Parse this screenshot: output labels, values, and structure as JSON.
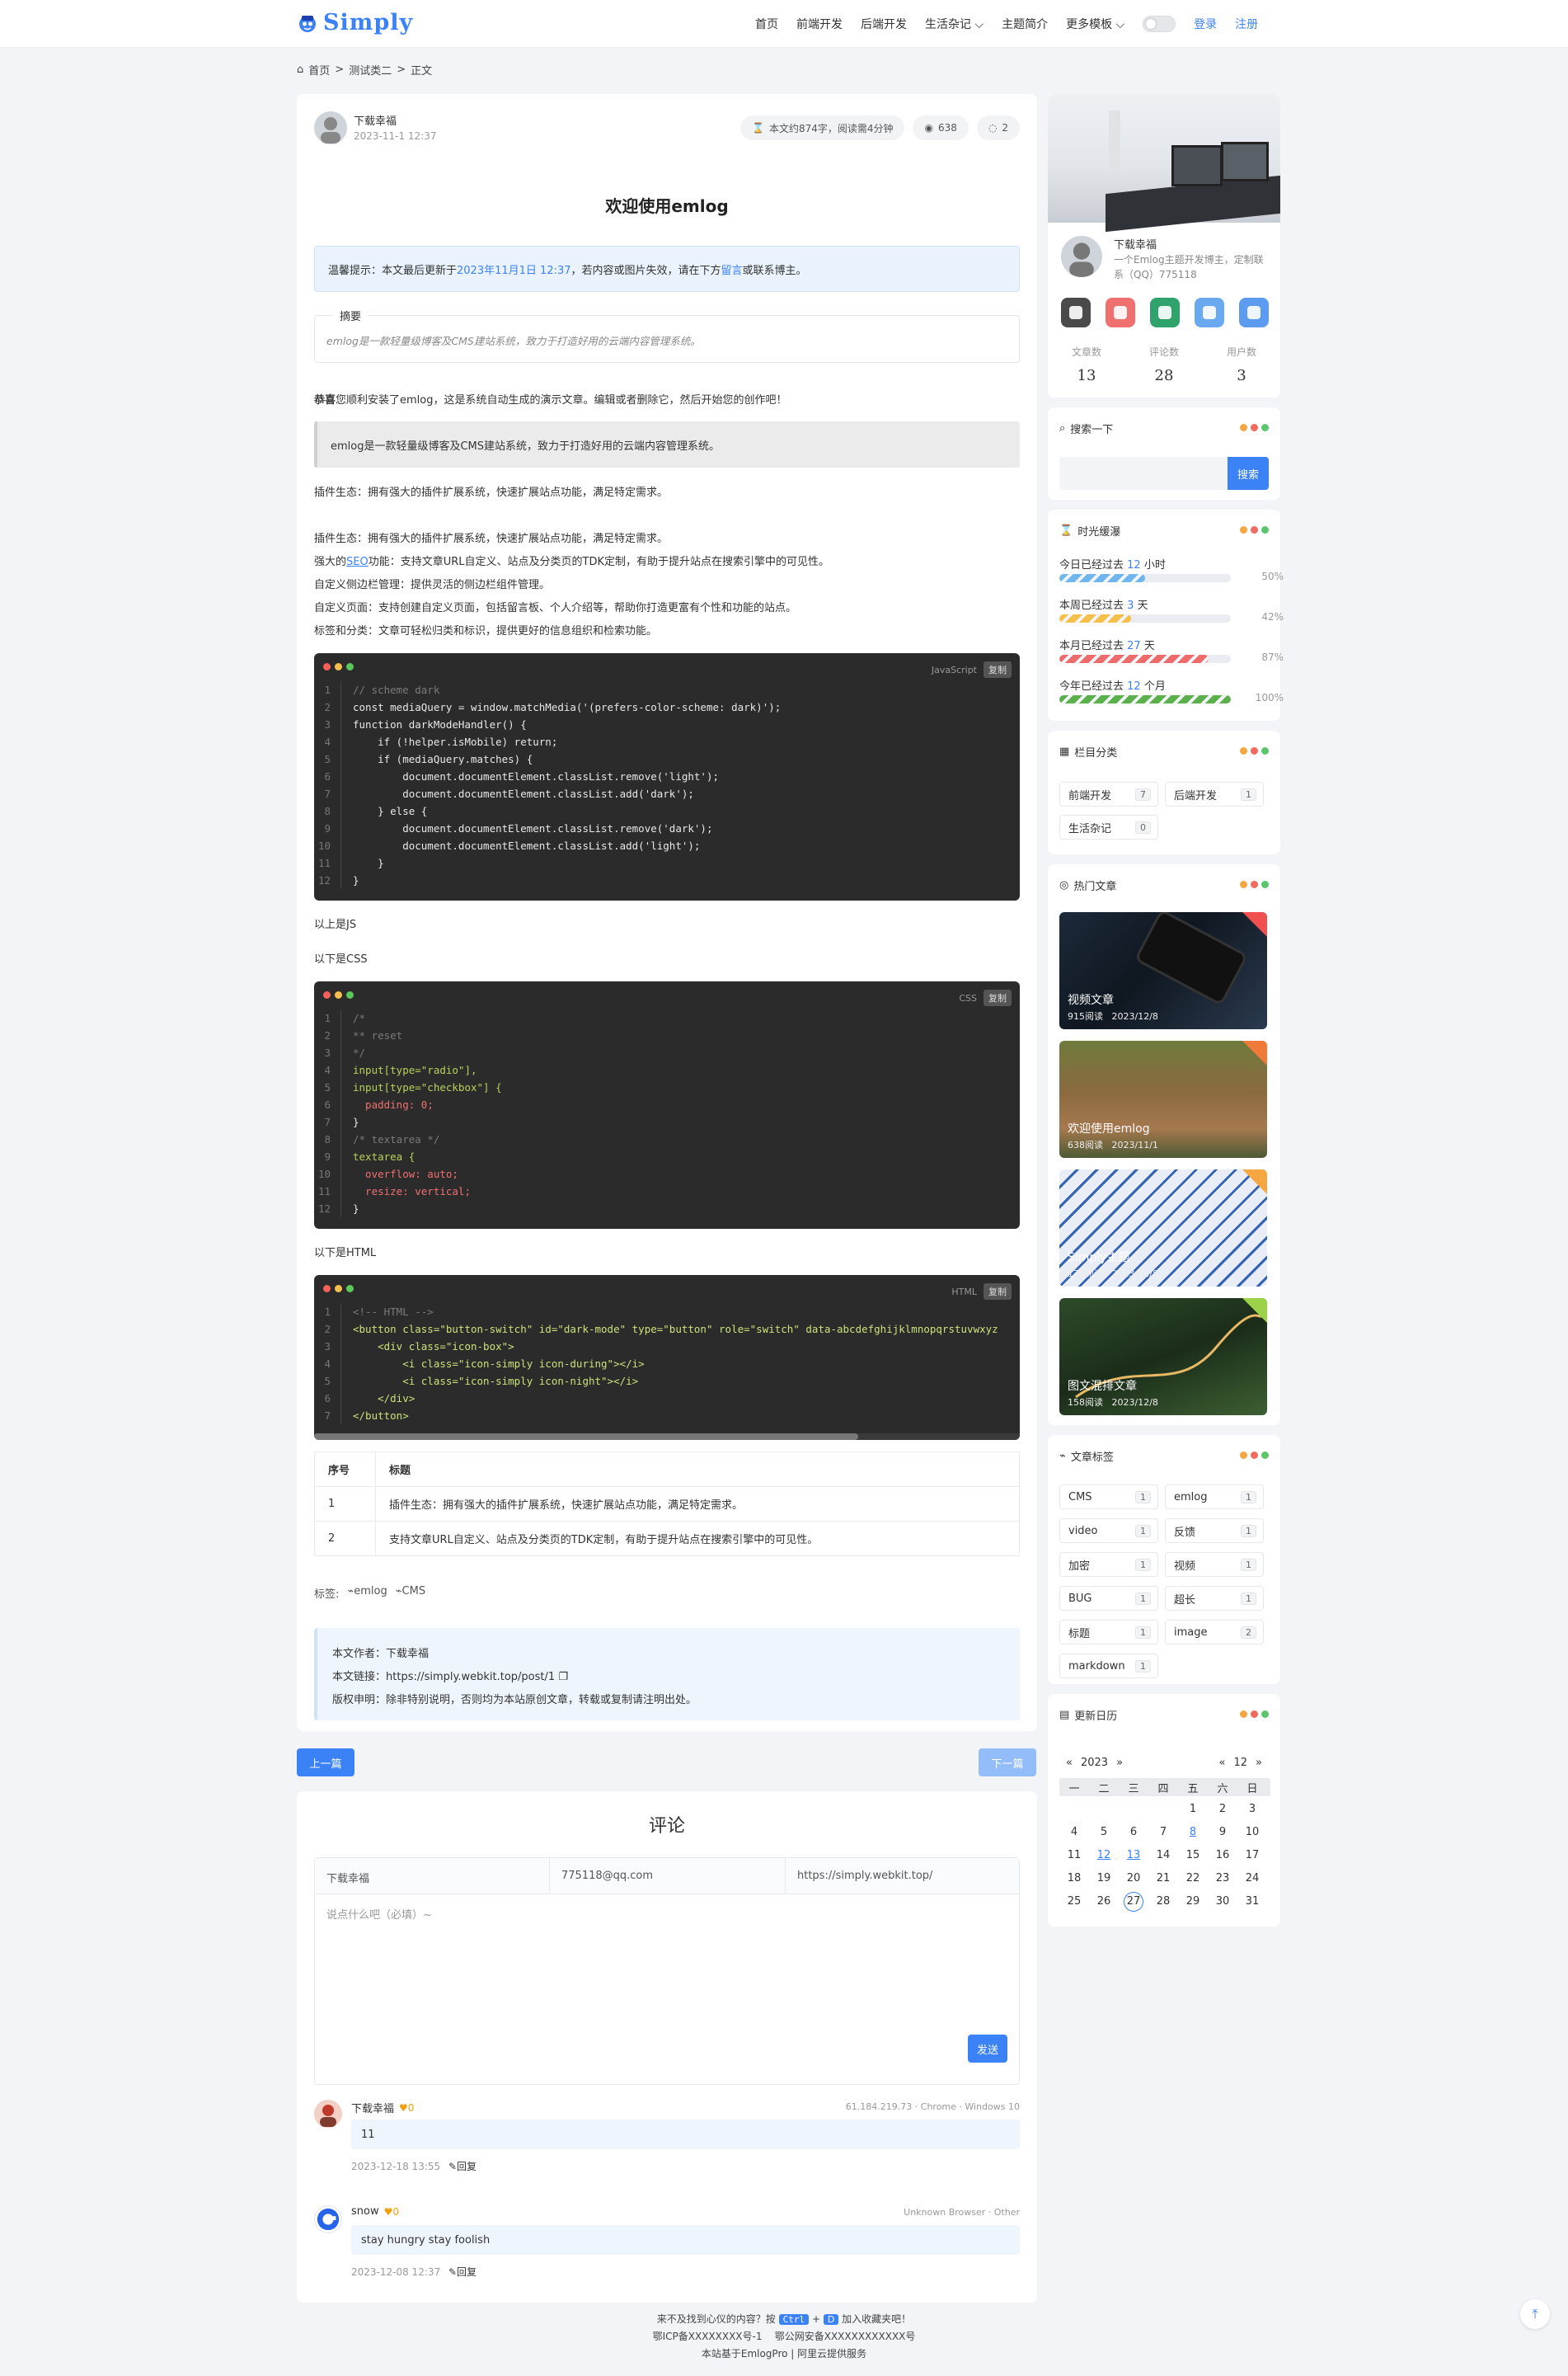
{
  "header": {
    "logo_text": "Simply",
    "nav": [
      "首页",
      "前端开发",
      "后端开发",
      "生活杂记",
      "主题简介",
      "更多模板"
    ],
    "login": "登录",
    "register": "注册"
  },
  "breadcrumb": [
    "首页",
    "测试类二",
    "正文"
  ],
  "article": {
    "author": "下载幸福",
    "date": "2023-11-1 12:37",
    "word_count": "本文约874字，阅读需4分钟",
    "views": "638",
    "comments": "2",
    "title": "欢迎使用emlog",
    "notice_prefix": "温馨提示：本文最后更新于",
    "notice_date": "2023年11月1日 12:37",
    "notice_mid": "，若内容或图片失效，请在下方",
    "notice_link": "留言",
    "notice_suffix": "或联系博主。",
    "summary_title": "摘要",
    "summary": "emlog是一款轻量级博客及CMS建站系统，致力于打造好用的云端内容管理系统。",
    "intro_bold": "恭喜",
    "intro_rest": "您顺利安装了emlog，这是系统自动生成的演示文章。编辑或者删除它，然后开始您的创作吧！",
    "quote": "emlog是一款轻量级博客及CMS建站系统，致力于打造好用的云端内容管理系统。",
    "p1": "插件生态：拥有强大的插件扩展系统，快速扩展站点功能，满足特定需求。",
    "list": [
      "插件生态：拥有强大的插件扩展系统，快速扩展站点功能，满足特定需求。",
      "强大的SEO功能：支持文章URL自定义、站点及分类页的TDK定制，有助于提升站点在搜索引擎中的可见性。",
      "自定义侧边栏管理：提供灵活的侧边栏组件管理。",
      "自定义页面：支持创建自定义页面，包括留言板、个人介绍等，帮助你打造更富有个性和功能的站点。",
      "标签和分类：文章可轻松归类和标识，提供更好的信息组织和检索功能。"
    ],
    "code_js_lang": "JavaScript",
    "code_copy": "复制",
    "code_js": [
      "// scheme dark",
      "const mediaQuery = window.matchMedia('(prefers-color-scheme: dark)');",
      "function darkModeHandler() {",
      "    if (!helper.isMobile) return;",
      "    if (mediaQuery.matches) {",
      "        document.documentElement.classList.remove('light');",
      "        document.documentElement.classList.add('dark');",
      "    } else {",
      "        document.documentElement.classList.remove('dark');",
      "        document.documentElement.classList.add('light');",
      "    }",
      "}"
    ],
    "after_js": "以上是JS",
    "before_css": "以下是CSS",
    "code_css_lang": "CSS",
    "code_css": [
      "/*",
      "** reset",
      "*/",
      "input[type=\"radio\"],",
      "input[type=\"checkbox\"] {",
      "  padding: 0;",
      "}",
      "/* textarea */",
      "textarea {",
      "  overflow: auto;",
      "  resize: vertical;",
      "}"
    ],
    "before_html": "以下是HTML",
    "code_html_lang": "HTML",
    "code_html": [
      "<!-- HTML -->",
      "<button class=\"button-switch\" id=\"dark-mode\" type=\"button\" role=\"switch\" data-abcdefghijklmnopqrstuvwxyz",
      "    <div class=\"icon-box\">",
      "        <i class=\"icon-simply icon-during\"></i>",
      "        <i class=\"icon-simply icon-night\"></i>",
      "    </div>",
      "</button>"
    ],
    "table_headers": [
      "序号",
      "标题"
    ],
    "table_rows": [
      [
        "1",
        "插件生态：拥有强大的插件扩展系统，快速扩展站点功能，满足特定需求。"
      ],
      [
        "2",
        "支持文章URL自定义、站点及分类页的TDK定制，有助于提升站点在搜索引擎中的可见性。"
      ]
    ],
    "tags_label": "标签:",
    "tags": [
      "emlog",
      "CMS"
    ],
    "copyright": {
      "author": "本文作者：下载幸福",
      "link_label": "本文链接：",
      "link": "https://simply.webkit.top/post/1",
      "statement": "版权申明：除非特别说明，否则均为本站原创文章，转载或复制请注明出处。"
    },
    "prev": "上一篇",
    "next": "下一篇"
  },
  "comment_form": {
    "title": "评论",
    "name": "下载幸福",
    "email": "775118@qq.com",
    "url": "https://simply.webkit.top/",
    "placeholder": "说点什么吧（必填）~",
    "submit": "发送"
  },
  "comments": [
    {
      "name": "下载幸福",
      "likes": "0",
      "meta": "61.184.219.73 · Chrome · Windows 10",
      "text": "11",
      "date": "2023-12-18 13:55",
      "reply": "回复"
    },
    {
      "name": "snow",
      "likes": "0",
      "meta": "Unknown Browser · Other",
      "text": "stay hungry stay foolish",
      "date": "2023-12-08 12:37",
      "reply": "回复"
    }
  ],
  "profile": {
    "name": "下载幸福",
    "bio": "一个Emlog主题开发博主，定制联系（QQ）775118",
    "icons": [
      "github-icon",
      "weibo-icon",
      "csdn-icon",
      "bilibili-icon",
      "qq-icon"
    ],
    "icon_colors": [
      "#4a4a4a",
      "#f07070",
      "#2fa36b",
      "#6aa8ef",
      "#5b9cf0"
    ],
    "stats": [
      {
        "label": "文章数",
        "value": "13"
      },
      {
        "label": "评论数",
        "value": "28"
      },
      {
        "label": "用户数",
        "value": "3"
      }
    ]
  },
  "search": {
    "title": "搜索一下",
    "button": "搜索"
  },
  "time": {
    "title": "时光缓瀑",
    "items": [
      {
        "pre": "今日已经过去",
        "num": "12",
        "unit": "小时",
        "pct": "50%",
        "fraction": 0.5,
        "color": "#6fb6ee"
      },
      {
        "pre": "本周已经过去",
        "num": "3",
        "unit": "天",
        "pct": "42%",
        "fraction": 0.42,
        "color": "#f5c04a"
      },
      {
        "pre": "本月已经过去",
        "num": "27",
        "unit": "天",
        "pct": "87%",
        "fraction": 0.87,
        "color": "#ee6b6b"
      },
      {
        "pre": "今年已经过去",
        "num": "12",
        "unit": "个月",
        "pct": "100%",
        "fraction": 1.0,
        "color": "#5ab04a"
      }
    ]
  },
  "categories": {
    "title": "栏目分类",
    "items": [
      {
        "name": "前端开发",
        "count": "7"
      },
      {
        "name": "后端开发",
        "count": "1"
      },
      {
        "name": "生活杂记",
        "count": "0"
      }
    ]
  },
  "hot": {
    "title": "热门文章",
    "items": [
      {
        "title": "视频文章",
        "views": "915阅读",
        "date": "2023/12/8",
        "rank": "1"
      },
      {
        "title": "欢迎使用emlog",
        "views": "638阅读",
        "date": "2023/11/1",
        "rank": "2"
      },
      {
        "title": "Simply主题",
        "views": "172阅读",
        "date": "2023/12/8",
        "rank": "3"
      },
      {
        "title": "图文混排文章",
        "views": "158阅读",
        "date": "2023/12/8",
        "rank": "4"
      }
    ]
  },
  "tags_panel": {
    "title": "文章标签",
    "items": [
      {
        "name": "CMS",
        "count": "1"
      },
      {
        "name": "emlog",
        "count": "1"
      },
      {
        "name": "video",
        "count": "1"
      },
      {
        "name": "反馈",
        "count": "1"
      },
      {
        "name": "加密",
        "count": "1"
      },
      {
        "name": "视频",
        "count": "1"
      },
      {
        "name": "BUG",
        "count": "1"
      },
      {
        "name": "超长",
        "count": "1"
      },
      {
        "name": "标题",
        "count": "1"
      },
      {
        "name": "image",
        "count": "2"
      },
      {
        "name": "markdown",
        "count": "1"
      }
    ]
  },
  "calendar": {
    "title": "更新日历",
    "year": "2023",
    "month": "12",
    "weekdays": [
      "一",
      "二",
      "三",
      "四",
      "五",
      "六",
      "日"
    ],
    "weeks": [
      [
        "",
        "",
        "",
        "",
        "1",
        "2",
        "3"
      ],
      [
        "4",
        "5",
        "6",
        "7",
        "8",
        "9",
        "10"
      ],
      [
        "11",
        "12",
        "13",
        "14",
        "15",
        "16",
        "17"
      ],
      [
        "18",
        "19",
        "20",
        "21",
        "22",
        "23",
        "24"
      ],
      [
        "25",
        "26",
        "27",
        "28",
        "29",
        "30",
        "31"
      ]
    ],
    "linked": [
      "8",
      "12",
      "13"
    ],
    "today": "27"
  },
  "footer": {
    "line1_pre": "来不及找到心仪的内容？按",
    "key1": "Ctrl",
    "plus": "+",
    "key2": "D",
    "line1_post": "加入收藏夹吧！",
    "line2": "鄂ICP备XXXXXXXX号-1    鄂公网安备XXXXXXXXXXXX号",
    "line3": "本站基于EmlogPro | 阿里云提供服务"
  }
}
